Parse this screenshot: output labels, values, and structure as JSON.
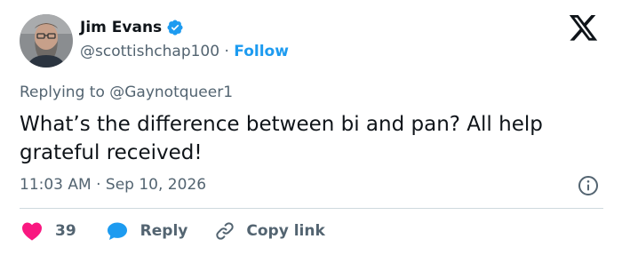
{
  "tweet": {
    "author": {
      "name": "Jim Evans",
      "handle": "@scottishchap100",
      "separator": "·",
      "follow_label": "Follow",
      "verified": true
    },
    "reply_context": {
      "prefix": "Replying to",
      "mention": "@Gaynotqueer1"
    },
    "text": "What’s the difference between bi and pan? All help grateful received!",
    "time": "11:03 AM",
    "date_separator": "·",
    "date": "Sep 10, 2026",
    "actions": {
      "like_count": "39",
      "reply_label": "Reply",
      "copy_link_label": "Copy link"
    },
    "icons": {
      "verified": "verified-badge-icon",
      "logo": "x-logo-icon",
      "info": "info-icon",
      "like": "heart-icon",
      "reply": "speech-bubble-icon",
      "copy": "link-icon"
    },
    "colors": {
      "accent": "#1d9bf0",
      "like": "#f91880",
      "text": "#0f1419",
      "secondary": "#536471",
      "divider": "#cfd9de"
    }
  }
}
